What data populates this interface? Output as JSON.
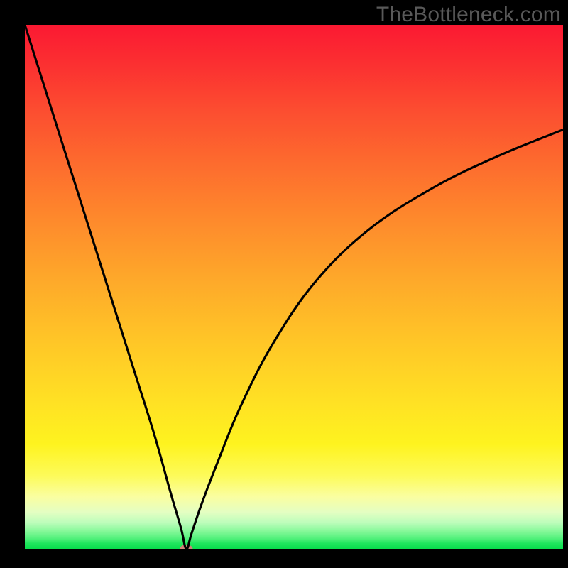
{
  "watermark": "TheBottleneck.com",
  "chart_data": {
    "type": "line",
    "title": "",
    "xlabel": "",
    "ylabel": "",
    "xlim": [
      0,
      100
    ],
    "ylim": [
      0,
      100
    ],
    "grid": false,
    "legend": false,
    "background_gradient": {
      "orientation": "vertical",
      "stops": [
        {
          "pos": 0.0,
          "color": "#fb1932",
          "meaning": "high bottleneck"
        },
        {
          "pos": 0.5,
          "color": "#fea72a"
        },
        {
          "pos": 0.8,
          "color": "#fef31f"
        },
        {
          "pos": 0.95,
          "color": "#bdfdbb"
        },
        {
          "pos": 1.0,
          "color": "#09dd4c",
          "meaning": "no bottleneck"
        }
      ]
    },
    "series": [
      {
        "name": "bottleneck-curve",
        "color": "#000000",
        "x": [
          0,
          4,
          8,
          12,
          16,
          20,
          24,
          27,
          29,
          30,
          31,
          33,
          36,
          40,
          46,
          54,
          64,
          76,
          88,
          100
        ],
        "y": [
          100,
          87,
          74,
          61,
          48,
          35,
          22,
          11,
          4,
          0,
          3,
          9,
          17,
          27,
          39,
          51,
          61,
          69,
          75,
          80
        ]
      }
    ],
    "marker": {
      "name": "optimal-point",
      "x": 30,
      "y": 0,
      "color": "#ce8177",
      "rx": 9,
      "ry": 6
    }
  }
}
